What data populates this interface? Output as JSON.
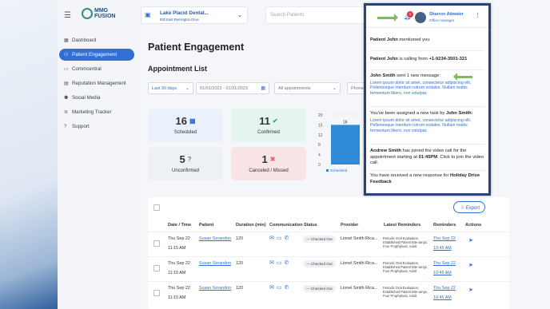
{
  "logo": {
    "text1": "MMG",
    "text2": "FUSION"
  },
  "sidebar": {
    "items": [
      {
        "label": "Dashboard",
        "icon": "grid-icon"
      },
      {
        "label": "Patient Engagement",
        "icon": "users-icon"
      },
      {
        "label": "Commcentral",
        "icon": "chat-icon"
      },
      {
        "label": "Reputation Management",
        "icon": "chart-icon"
      },
      {
        "label": "Social Media",
        "icon": "people-icon"
      },
      {
        "label": "Marketing Tracker",
        "icon": "tracker-icon"
      },
      {
        "label": "Support",
        "icon": "help-icon"
      }
    ]
  },
  "location": {
    "name": "Lake Placid Dental...",
    "address": "930 East Remington Drive"
  },
  "search": {
    "placeholder": "Search Patients"
  },
  "user": {
    "name": "Sharron Attwater",
    "role": "Office manager",
    "badge": "1"
  },
  "page": {
    "title": "Patient Engagement",
    "subtitle": "Appointment List"
  },
  "filters": {
    "range": "Last 30 days",
    "dates": "01/01/2023 - 01/31/2023",
    "appointments": "All appointments",
    "phone": "Phone"
  },
  "stats": {
    "scheduled": {
      "value": "16",
      "label": "Scheduled"
    },
    "confirmed": {
      "value": "11",
      "label": "Confirmed"
    },
    "unconfirmed": {
      "value": "5",
      "label": "Unconfirmed"
    },
    "canceled": {
      "value": "1",
      "label": "Canceled / Missed"
    }
  },
  "chart_data": {
    "type": "bar",
    "categories": [
      "Scheduled"
    ],
    "series": [
      {
        "name": "Scheduled",
        "values": [
          16
        ]
      }
    ],
    "yticks": [
      "20",
      "15",
      "12",
      "8",
      "4",
      "0"
    ],
    "data_label": "16",
    "ylim": [
      0,
      20
    ],
    "colors": {
      "scheduled": "#2f8bd8"
    },
    "legend": [
      "Scheduled"
    ]
  },
  "table": {
    "export_label": "Export",
    "headers": [
      "Date / Time",
      "Patient",
      "Duration (min)",
      "Communication",
      "Status",
      "Provider",
      "Latest Reminders",
      "Reminders",
      "Actions"
    ],
    "rows": [
      {
        "date": "Thu Sep 22",
        "time": "11:15 AM",
        "patient": "Susan Serandon",
        "duration": "120",
        "status": "Checked Out",
        "provider": "Lionel Smith Rica...",
        "reminder_text": "Periodic Oral Evaluation, Established Patient Bite wings, Four Prophylaxis, Adult",
        "rem_date": "Thu Sep 22",
        "rem_time": "10:45 AM"
      },
      {
        "date": "Thu Sep 22",
        "time": "11:15 AM",
        "patient": "Susan Serandon",
        "duration": "120",
        "status": "Checked Out",
        "provider": "Lionel Smith Rica...",
        "reminder_text": "Periodic Oral Evaluation, Established Patient Bite wings, Four Prophylaxis, Adult",
        "rem_date": "Thu Sep 22",
        "rem_time": "10:45 AM"
      },
      {
        "date": "Thu Sep 22",
        "time": "11:15 AM",
        "patient": "Susan Serandon",
        "duration": "120",
        "status": "Checked Out",
        "provider": "Lionel Smith Rica...",
        "reminder_text": "Periodic Oral Evaluation, Established Patient Bite wings, Four Prophylaxis, Adult",
        "rem_date": "Thu Sep 22",
        "rem_time": "10:45 AM"
      }
    ]
  },
  "notifications": {
    "n1": {
      "name": "Patient John",
      "text": " mentioned you"
    },
    "n2": {
      "name": "Patient John",
      "text": " is calling from ",
      "phone": "+1-9234-3501-321"
    },
    "n3": {
      "name": "John Smith",
      "text": " sent 1 new message:",
      "lorem": "Lorem ipsum dolor sit amet, consectetur adipiscing elit. Pellentesque interdum rutrum sodales. Nullam mattis fermentum libero, non volutpat."
    },
    "n4": {
      "text": "You've been assigned a new task  by ",
      "name": "John Smith:",
      "lorem": "Lorem ipsum dolor sit amet, consectetur adipiscing elit. Pellentesque interdum rutrum sodales. Nullam mattis fermentum libero, non volutpat."
    },
    "n5": {
      "name": "Andrew Smith",
      "text": " has joined the video call for the appointment starting at ",
      "time": "01:45PM",
      "text2": ". Click to join the video call."
    },
    "n6": {
      "text": "You have received a new response for ",
      "name": "Holiday Drive Feedback"
    }
  }
}
